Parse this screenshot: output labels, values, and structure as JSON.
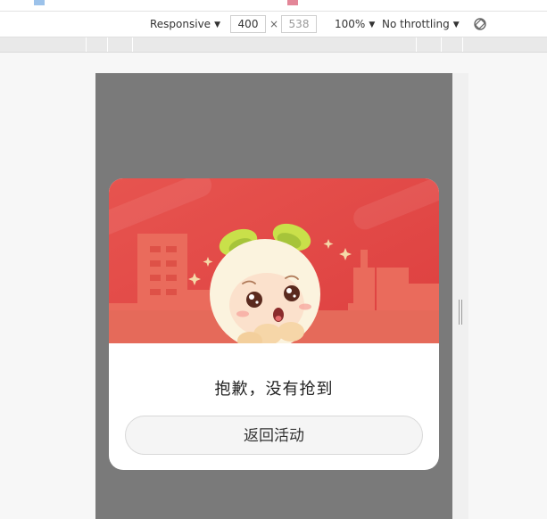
{
  "device_toolbar": {
    "device_label": "Responsive",
    "width": "400",
    "height": "538",
    "zoom_label": "100%",
    "throttle_label": "No throttling",
    "icon_rotate": "rotate-icon"
  },
  "modal": {
    "message": "抱歉，没有抢到",
    "button_label": "返回活动",
    "colors": {
      "banner_red": "#e04a48",
      "skyline": "#ea6b5c",
      "bottom_band": "#e56a5a"
    }
  }
}
